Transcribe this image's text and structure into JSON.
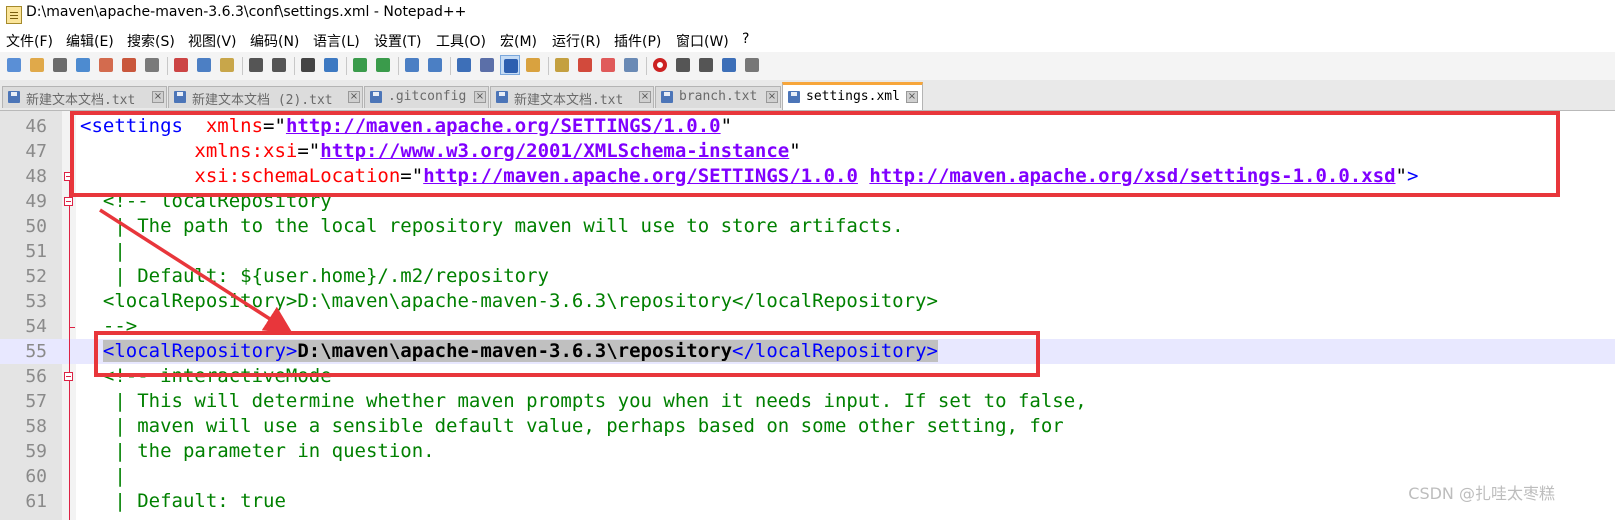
{
  "window": {
    "title": "D:\\maven\\apache-maven-3.6.3\\conf\\settings.xml - Notepad++"
  },
  "menu": [
    "文件(F)",
    "编辑(E)",
    "搜索(S)",
    "视图(V)",
    "编码(N)",
    "语言(L)",
    "设置(T)",
    "工具(O)",
    "宏(M)",
    "运行(R)",
    "插件(P)",
    "窗口(W)",
    "?"
  ],
  "toolbar": {
    "buttons": [
      "new-file-icon",
      "open-file-icon",
      "save-icon",
      "save-all-icon",
      "close-icon",
      "close-all-icon",
      "print-icon",
      "cut-icon",
      "copy-icon",
      "paste-icon",
      "undo-icon",
      "redo-icon",
      "find-icon",
      "replace-icon",
      "zoom-in-icon",
      "zoom-out-icon",
      "sync-vertical-icon",
      "sync-horizontal-icon",
      "word-wrap-icon",
      "show-all-chars-icon",
      "indent-guide-icon",
      "define-language-icon",
      "doc-map-icon",
      "function-list-icon",
      "folder-workspace-icon",
      "monitoring-icon",
      "record-macro-icon",
      "stop-record-icon",
      "play-macro-icon",
      "run-macro-multiple-icon",
      "save-macro-icon"
    ],
    "active": "indent-guide-icon"
  },
  "tabs": [
    {
      "label": "新建文本文档.txt"
    },
    {
      "label": "新建文本文档 (2).txt"
    },
    {
      "label": ".gitconfig"
    },
    {
      "label": "新建文本文档.txt"
    },
    {
      "label": "branch.txt"
    },
    {
      "label": "settings.xml"
    }
  ],
  "editor": {
    "lines": [
      {
        "n": "46",
        "t": [
          "<settings ",
          " xmlns",
          "=",
          "\"",
          "http://maven.apache.org/SETTINGS/1.0.0",
          "\""
        ]
      },
      {
        "n": "47",
        "t": [
          "          ",
          "xmlns:xsi",
          "=",
          "\"",
          "http://www.w3.org/2001/XMLSchema-instance",
          "\""
        ]
      },
      {
        "n": "48",
        "t": [
          "          ",
          "xsi:schemaLocation",
          "=",
          "\"",
          "http://maven.apache.org/SETTINGS/1.0.0",
          " ",
          "http://maven.apache.org/xsd/settings-1.0.0.xsd",
          "\"",
          ">"
        ]
      },
      {
        "n": "49",
        "t": [
          "  <!-- localRepository"
        ]
      },
      {
        "n": "50",
        "t": [
          "   | The path to the local repository maven will use to store artifacts."
        ]
      },
      {
        "n": "51",
        "t": [
          "   |"
        ]
      },
      {
        "n": "52",
        "t": [
          "   | Default: ${user.home}/.m2/repository"
        ]
      },
      {
        "n": "53",
        "t": [
          "  <localRepository>D:\\maven\\apache-maven-3.6.3\\repository</localRepository>"
        ]
      },
      {
        "n": "54",
        "t": [
          "  -->"
        ]
      },
      {
        "n": "55",
        "t": [
          "  ",
          "<localRepository>",
          "D:\\maven\\apache-maven-3.6.3\\repository",
          "</localRepository>"
        ]
      },
      {
        "n": "56",
        "t": [
          "  <!-- interactiveMode"
        ]
      },
      {
        "n": "57",
        "t": [
          "   | This will determine whether maven prompts you when it needs input. If set to false,"
        ]
      },
      {
        "n": "58",
        "t": [
          "   | maven will use a sensible default value, perhaps based on some other setting, for"
        ]
      },
      {
        "n": "59",
        "t": [
          "   | the parameter in question."
        ]
      },
      {
        "n": "60",
        "t": [
          "   |"
        ]
      },
      {
        "n": "61",
        "t": [
          "   | Default: true"
        ]
      }
    ]
  },
  "watermark": "CSDN @扎哇太枣糕",
  "colors": {
    "highlight_box": "#e8363b",
    "tag": "#0000ff",
    "attribute": "#ff0000",
    "value": "#8000ff",
    "comment": "#008000",
    "current_line": "#e8e8ff",
    "tab_accent": "#f7a63b"
  }
}
